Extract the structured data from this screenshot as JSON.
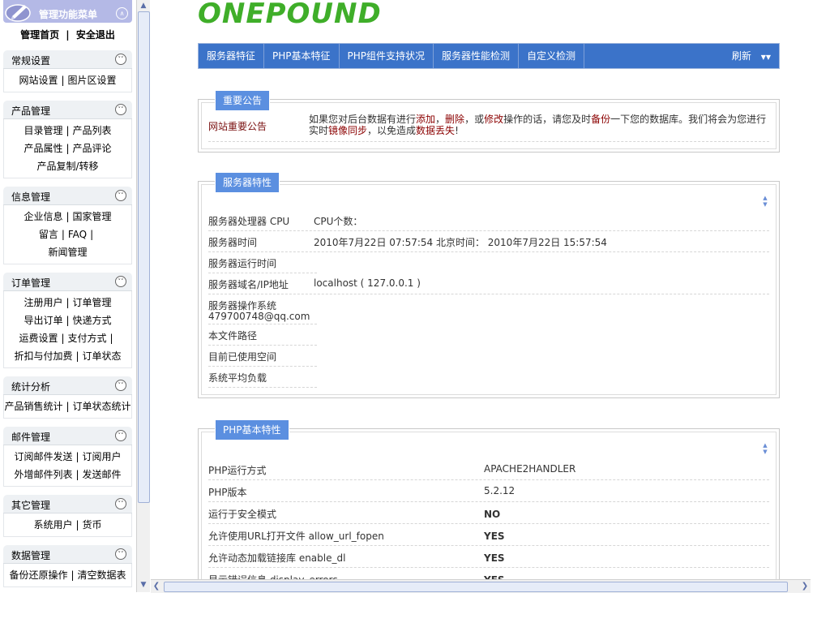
{
  "menu": {
    "header_title": "管理功能菜单",
    "home_link": "管理首页",
    "divider": "|",
    "logout_link": "安全退出",
    "groups": [
      {
        "title": "常规设置",
        "lines": [
          [
            "网站设置",
            "图片区设置"
          ]
        ]
      },
      {
        "title": "产品管理",
        "lines": [
          [
            "目录管理",
            "产品列表"
          ],
          [
            "产品属性",
            "产品评论"
          ],
          [
            "产品复制/转移"
          ]
        ]
      },
      {
        "title": "信息管理",
        "lines": [
          [
            "企业信息",
            "国家管理"
          ],
          [
            "留言",
            "FAQ",
            ""
          ],
          [
            "新闻管理"
          ]
        ]
      },
      {
        "title": "订单管理",
        "lines": [
          [
            "注册用户",
            "订单管理"
          ],
          [
            "导出订单",
            "快递方式"
          ],
          [
            "运费设置",
            "支付方式",
            ""
          ],
          [
            "折扣与付加费",
            "订单状态"
          ]
        ]
      },
      {
        "title": "统计分析",
        "lines": [
          [
            "产品销售统计",
            "订单状态统计"
          ]
        ]
      },
      {
        "title": "邮件管理",
        "lines": [
          [
            "订阅邮件发送",
            "订阅用户"
          ],
          [
            "外增邮件列表",
            "发送邮件"
          ]
        ]
      },
      {
        "title": "其它管理",
        "lines": [
          [
            "系统用户",
            "货币"
          ]
        ]
      },
      {
        "title": "数据管理",
        "lines": [
          [
            "备份还原操作",
            "清空数据表"
          ]
        ]
      }
    ]
  },
  "brand": "ONEPOUND",
  "nav": {
    "tabs": [
      "服务器特征",
      "PHP基本特征",
      "PHP组件支持状况",
      "服务器性能检测",
      "自定义检测"
    ],
    "refresh": "刷新"
  },
  "notice": {
    "legend": "重要公告",
    "label": "网站重要公告",
    "t1": "如果您对后台数据有进行",
    "h1": "添加",
    "t2": "，",
    "h2": "删除",
    "t3": "，或",
    "h3": "修改",
    "t4": "操作的话，请您及时",
    "h4": "备份",
    "t5": "一下您的数据库。我们将会为您进行实时",
    "h5": "镜像同步",
    "t6": "，以免造成",
    "h6": "数据丢失",
    "t7": "!"
  },
  "server": {
    "legend": "服务器特性",
    "rows": [
      {
        "k": "服务器处理器 CPU",
        "v": "CPU个数："
      },
      {
        "k": "服务器时间",
        "v": "2010年7月22日 07:57:54 北京时间： 2010年7月22日 15:57:54"
      },
      {
        "k": "服务器运行时间",
        "v": ""
      },
      {
        "k": "服务器域名/IP地址",
        "v": "localhost ( 127.0.0.1 )"
      },
      {
        "k": "服务器操作系统",
        "k2": "479700748@qq.com",
        "v": ""
      },
      {
        "k": "本文件路径",
        "v": ""
      },
      {
        "k": "目前已使用空间",
        "v": ""
      },
      {
        "k": "系统平均负载",
        "v": ""
      }
    ]
  },
  "php": {
    "legend": "PHP基本特性",
    "rows": [
      {
        "k": "PHP运行方式",
        "v": "APACHE2HANDLER",
        "kind": "plain"
      },
      {
        "k": "PHP版本",
        "v": "5.2.12",
        "kind": "plain"
      },
      {
        "k": "运行于安全模式",
        "v": "NO",
        "kind": "no"
      },
      {
        "k": "允许使用URL打开文件 allow_url_fopen",
        "v": "YES",
        "kind": "yes"
      },
      {
        "k": "允许动态加载链接库 enable_dl",
        "v": "YES",
        "kind": "yes"
      },
      {
        "k": "显示错误信息 display_errors",
        "v": "YES",
        "kind": "yes"
      }
    ]
  },
  "colors": {
    "brand": "#3fae29",
    "nav": "#3b73c9",
    "legend": "#5b8fe0",
    "no": "#b3121c",
    "yes": "#3a9a14"
  }
}
